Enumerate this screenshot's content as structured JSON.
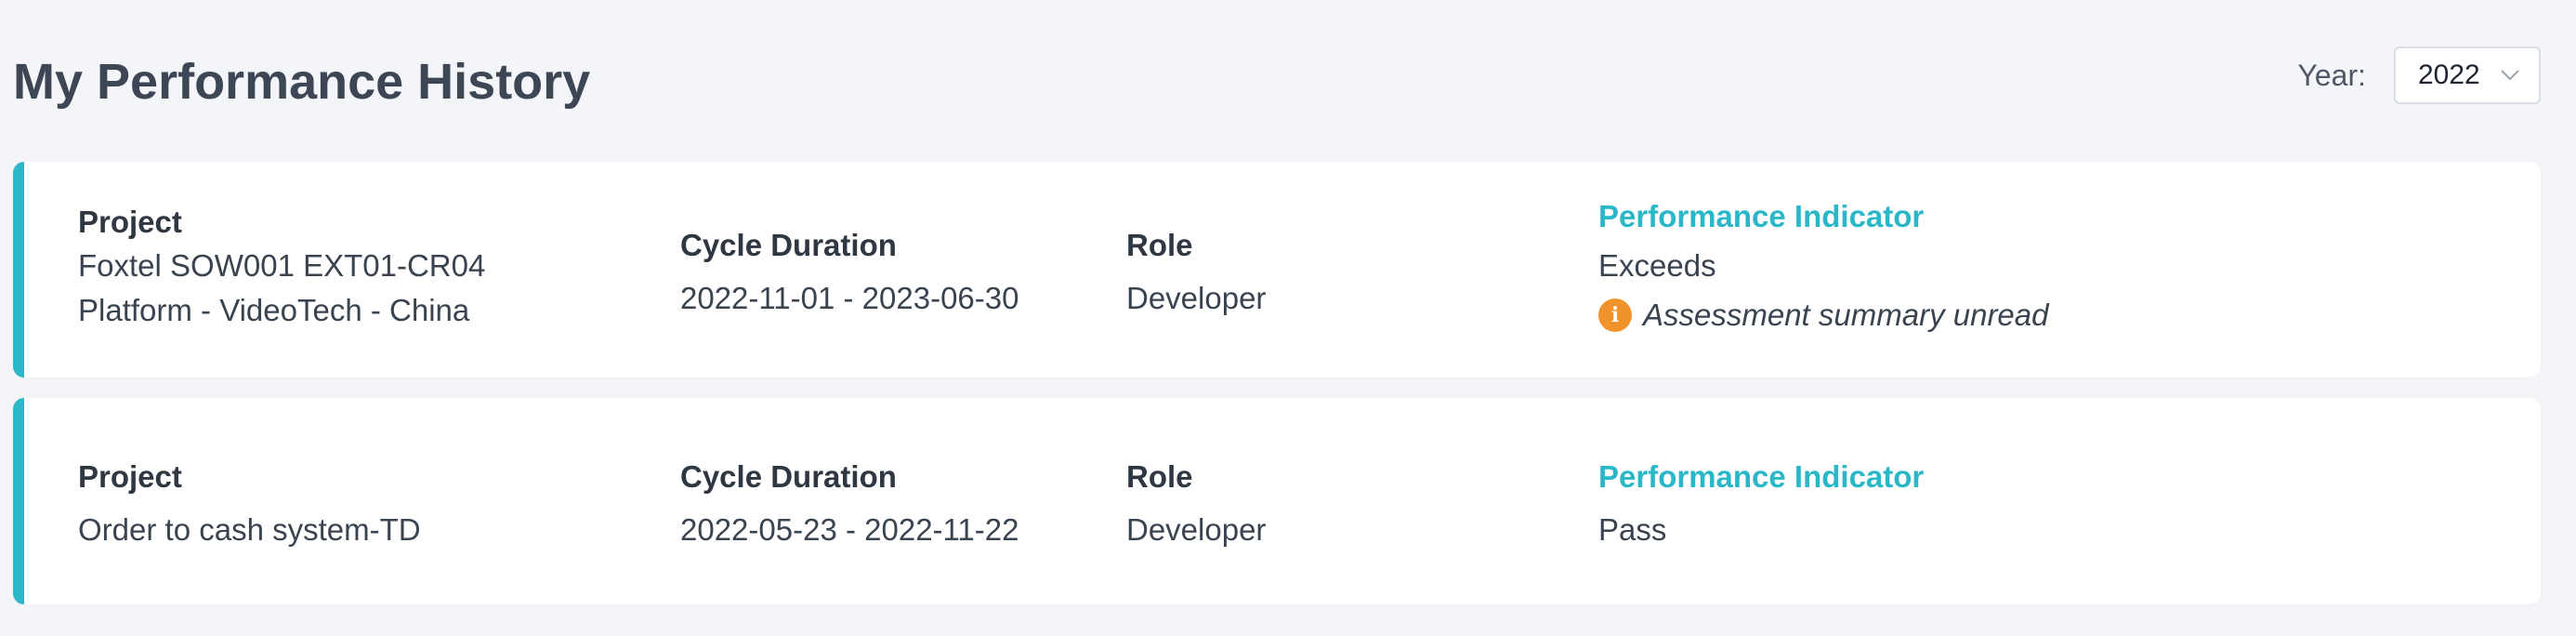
{
  "page": {
    "title": "My Performance History"
  },
  "filter": {
    "year_label": "Year:",
    "year_value": "2022"
  },
  "colors": {
    "accent": "#2ab8c8",
    "warning": "#f0932b",
    "background": "#f4f5f8"
  },
  "cards": [
    {
      "project_heading": "Project",
      "project_lines": [
        "Foxtel SOW001 EXT01-CR04",
        "Platform - VideoTech - China"
      ],
      "duration_heading": "Cycle Duration",
      "duration": "2022-11-01 - 2023-06-30",
      "role_heading": "Role",
      "role": "Developer",
      "indicator_heading": "Performance Indicator",
      "indicator": "Exceeds",
      "notice_icon": "info-icon",
      "notice": "Assessment summary unread"
    },
    {
      "project_heading": "Project",
      "project_lines": [
        "Order to cash system-TD"
      ],
      "duration_heading": "Cycle Duration",
      "duration": "2022-05-23 - 2022-11-22",
      "role_heading": "Role",
      "role": "Developer",
      "indicator_heading": "Performance Indicator",
      "indicator": "Pass"
    }
  ]
}
